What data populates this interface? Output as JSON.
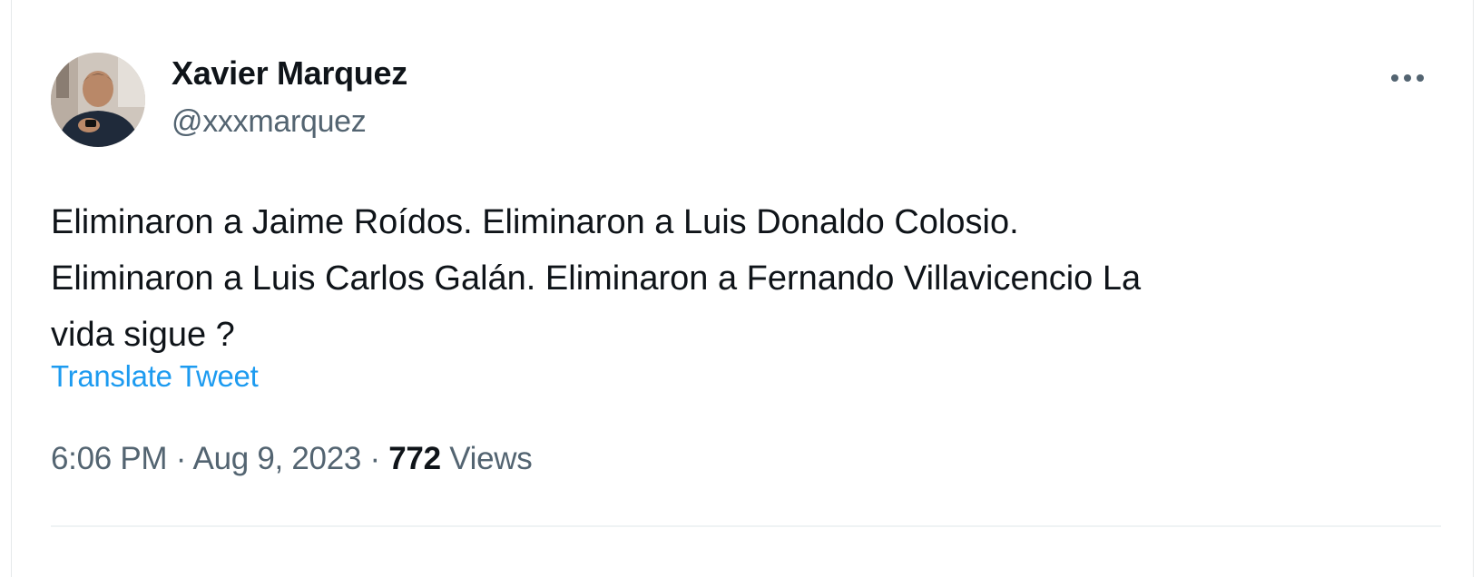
{
  "tweet": {
    "author": {
      "display_name": "Xavier Marquez",
      "handle": "@xxxmarquez",
      "avatar_icon": "avatar-photo"
    },
    "more_icon": "more-horizontal-icon",
    "text": "Eliminaron a Jaime Roídos. Eliminaron a Luis Donaldo Colosio.\nEliminaron a Luis Carlos Galán. Eliminaron a Fernando Villavicencio   La\nvida sigue ?",
    "translate_label": "Translate Tweet",
    "time": "6:06 PM",
    "separator": "·",
    "date": "Aug 9, 2023",
    "views_count": "772",
    "views_label": "Views"
  },
  "colors": {
    "text_primary": "#0f1419",
    "text_secondary": "#536471",
    "link": "#1d9bf0",
    "divider": "#eff3f4"
  }
}
